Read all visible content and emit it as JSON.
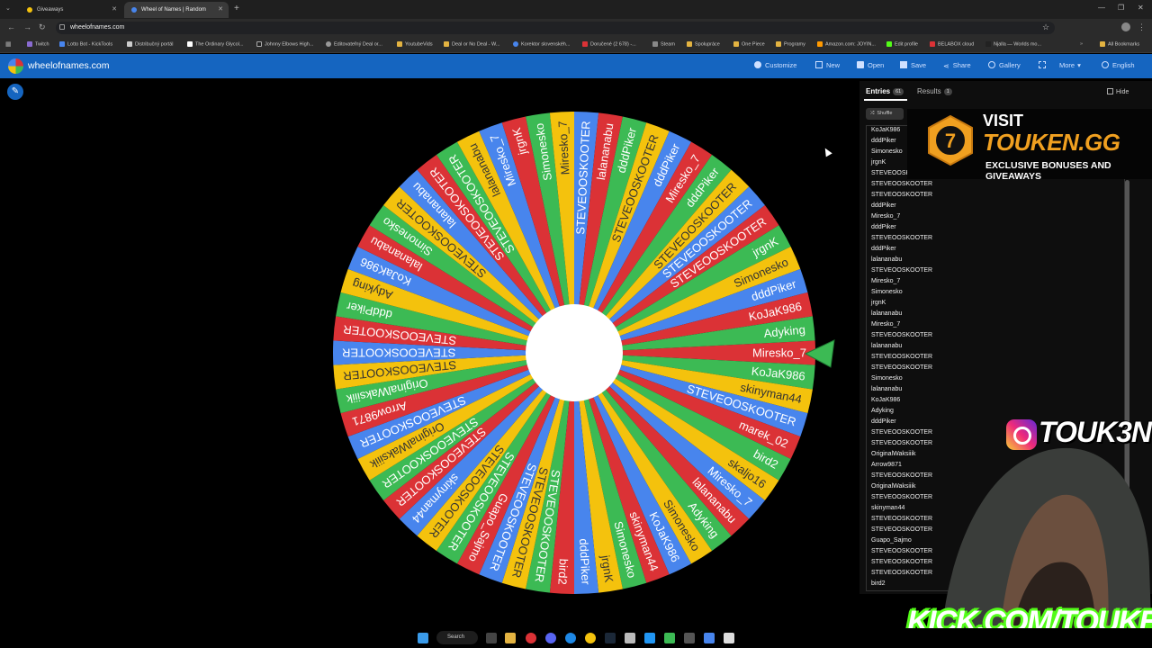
{
  "browser": {
    "tabs": [
      {
        "label": "Giveaways",
        "active": false
      },
      {
        "label": "Wheel of Names | Random",
        "active": true
      }
    ],
    "new_tab": "+",
    "url": "wheelofnames.com",
    "bookmarks": [
      "Twitch",
      "Lotto Bot - KickTools",
      "Distribučný portál",
      "The Ordinary Glycol...",
      "Johnny Elbows High...",
      "Editovateľný Deal or...",
      "YoutubeVids",
      "Deal or No Deal - W...",
      "Korektor slovenskéh...",
      "Doručené (2 678) -...",
      "Steam",
      "Spolupráce",
      "One Piece",
      "Programy",
      "Amazon.com: JOYIN...",
      "Edit profile",
      "BELABOX cloud",
      "Njalla — Worlds mo...",
      "All Bookmarks"
    ]
  },
  "app": {
    "site_name": "wheelofnames.com",
    "menu": [
      "Customize",
      "New",
      "Open",
      "Save",
      "Share",
      "Gallery",
      "More",
      "English"
    ]
  },
  "panel": {
    "tab_entries": "Entries",
    "entries_count": "61",
    "tab_results": "Results",
    "results_count": "1",
    "hide_label": "Hide",
    "shuffle_label": "Shuffle",
    "entries": [
      "KoJaK986",
      "dddPiker",
      "Simonesko",
      "jrgnK",
      "STEVEOOSKOOTER",
      "STEVEOOSKOOTER",
      "STEVEOOSKOOTER",
      "dddPiker",
      "Miresko_7",
      "dddPiker",
      "STEVEOOSKOOTER",
      "dddPiker",
      "lalananabu",
      "STEVEOOSKOOTER",
      "Miresko_7",
      "Simonesko",
      "jrgnK",
      "lalananabu",
      "Miresko_7",
      "STEVEOOSKOOTER",
      "lalananabu",
      "STEVEOOSKOOTER",
      "STEVEOOSKOOTER",
      "Simonesko",
      "lalananabu",
      "KoJaK986",
      "Adyking",
      "dddPiker",
      "STEVEOOSKOOTER",
      "STEVEOOSKOOTER",
      "OriginalWaksiiik",
      "Arrow9871",
      "STEVEOOSKOOTER",
      "OriginalWaksiiik",
      "STEVEOOSKOOTER",
      "skinyman44",
      "STEVEOOSKOOTER",
      "STEVEOOSKOOTER",
      "Guapo_Sajmo",
      "STEVEOOSKOOTER",
      "STEVEOOSKOOTER",
      "STEVEOOSKOOTER",
      "bird2"
    ]
  },
  "wheel": {
    "colors": [
      "#db3236",
      "#3cba54",
      "#f4c20d",
      "#4885ed"
    ],
    "slice_labels": [
      "Miresko_7",
      "KoJaK986",
      "skinyman44",
      "STEVEOOSKOOTER",
      "marek_02",
      "bird2",
      "skaljo16",
      "Miresko_7",
      "lalananabu",
      "Adyking",
      "Simonesko",
      "KoJaK986",
      "skinyman44",
      "Simonesko",
      "jrgnK",
      "dddPiker",
      "bird2",
      "STEVEOOSKOOTER",
      "STEVEOOSKOOTER",
      "STEVEOOSKOOTER",
      "Guapo_Sajmo",
      "STEVEOOSKOOTER",
      "STEVEOOSKOOTER",
      "skinyman44",
      "STEVEOOSKOOTER",
      "STEVEOOSKOOTER",
      "OriginalWaksiiik",
      "STEVEOOSKOOTER",
      "Arrow9871",
      "OriginalWaksiiik",
      "STEVEOOSKOOTER",
      "STEVEOOSKOOTER",
      "STEVEOOSKOOTER",
      "dddPiker",
      "Adyking",
      "KoJaK986",
      "lalananabu",
      "Simonesko",
      "STEVEOOSKOOTER",
      "lalananabu",
      "STEVEOOSKOOTER",
      "STEVEOOSKOOTER",
      "lalananabu",
      "Miresko_7",
      "jrgnK",
      "Simonesko",
      "Miresko_7",
      "STEVEOOSKOOTER",
      "lalananabu",
      "dddPiker",
      "STEVEOOSKOOTER",
      "dddPiker",
      "Miresko_7",
      "dddPiker",
      "STEVEOOSKOOTER",
      "STEVEOOSKOOTER",
      "STEVEOOSKOOTER",
      "jrgnK",
      "Simonesko",
      "dddPiker",
      "KoJaK986",
      "Adyking"
    ]
  },
  "overlays": {
    "promo_line1": "VISIT",
    "promo_line2": "TOUKEN.GG",
    "promo_line3": "EXCLUSIVE BONUSES AND GIVEAWAYS",
    "instagram": "TOUK3N",
    "kick": "KICK.COM/TOUKEN"
  },
  "taskbar": {
    "search_label": "Search"
  }
}
